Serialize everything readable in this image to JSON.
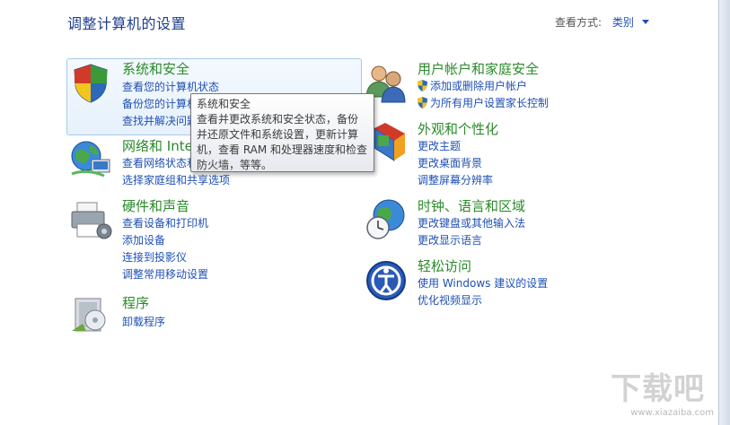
{
  "page": {
    "title": "调整计算机的设置"
  },
  "view_by": {
    "label": "查看方式:",
    "value": "类别"
  },
  "categories": {
    "system": {
      "title": "系统和安全",
      "links": [
        "查看您的计算机状态",
        "备份您的计算机",
        "查找并解决问题"
      ]
    },
    "network": {
      "title": "网络和 Internet",
      "links": [
        "查看网络状态和任务",
        "选择家庭组和共享选项"
      ]
    },
    "hardware": {
      "title": "硬件和声音",
      "links": [
        "查看设备和打印机",
        "添加设备",
        "连接到投影仪",
        "调整常用移动设置"
      ]
    },
    "programs": {
      "title": "程序",
      "links": [
        "卸载程序"
      ]
    },
    "users": {
      "title": "用户帐户和家庭安全",
      "links": [
        "添加或删除用户帐户",
        "为所有用户设置家长控制"
      ]
    },
    "appearance": {
      "title": "外观和个性化",
      "links": [
        "更改主题",
        "更改桌面背景",
        "调整屏幕分辨率"
      ]
    },
    "clock": {
      "title": "时钟、语言和区域",
      "links": [
        "更改键盘或其他输入法",
        "更改显示语言"
      ]
    },
    "ease": {
      "title": "轻松访问",
      "links": [
        "使用 Windows 建议的设置",
        "优化视频显示"
      ]
    }
  },
  "tooltip": {
    "title": "系统和安全",
    "body": "查看并更改系统和安全状态，备份并还原文件和系统设置，更新计算机，查看 RAM 和处理器速度和检查防火墙，等等。"
  },
  "watermark": {
    "big": "下载吧",
    "small": "www.xiazaiba.com"
  },
  "colors": {
    "title_green": "#2a8a2a",
    "link_blue": "#1e4fb4",
    "heading_blue": "#1e3c8c"
  }
}
